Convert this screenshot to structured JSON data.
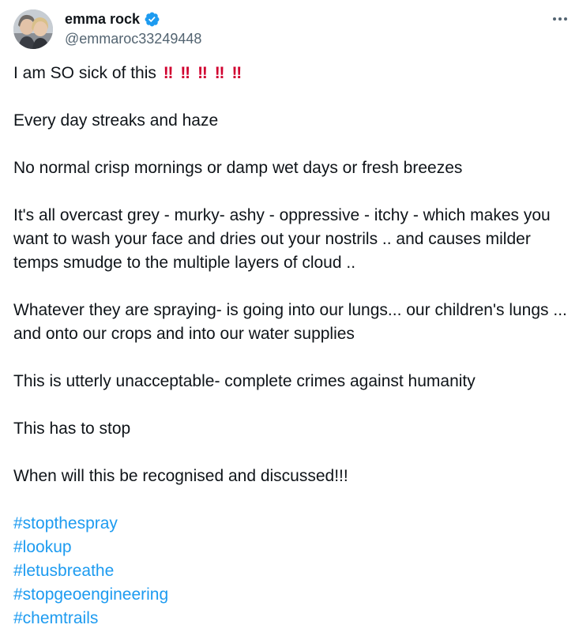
{
  "author": {
    "display_name": "emma rock",
    "handle": "@emmaroc33249448",
    "verified": true,
    "avatar_icon": "profile-photo-avatar"
  },
  "menu": {
    "icon": "more-horizontal-icon"
  },
  "tweet": {
    "first_line": "I am SO sick of this",
    "emoji": [
      "‼",
      "‼",
      "‼",
      "‼",
      "‼"
    ],
    "paragraphs": [
      "Every day streaks and haze",
      "No normal crisp mornings or damp wet days or fresh breezes",
      "It's all overcast grey - murky- ashy - oppressive - itchy - which makes you want to wash your face and dries out your nostrils .. and causes milder temps smudge to the multiple layers of cloud ..",
      "Whatever they are spraying- is going into our lungs... our children's lungs ... and onto our crops and into our water supplies",
      "This is utterly unacceptable- complete crimes against humanity",
      "This has to stop",
      "When will this be recognised and discussed!!!"
    ],
    "hashtags": [
      "#stopthespray",
      "#lookup",
      "#letusbreathe",
      "#stopgeoengineering",
      "#chemtrails"
    ]
  },
  "colors": {
    "text": "#0f1419",
    "secondary": "#536471",
    "link": "#1d9bf0",
    "verified_badge": "#1d9bf0",
    "emoji_red": "#d0002f"
  }
}
